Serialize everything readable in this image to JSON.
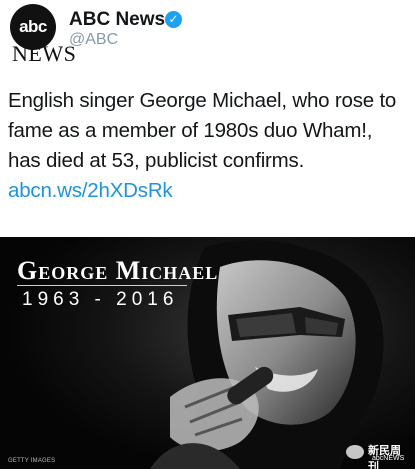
{
  "tweet": {
    "avatar": {
      "logo_text": "abc",
      "wordmark": "NEWS"
    },
    "account_name": "ABC News",
    "verified_icon": "verified-check-icon",
    "handle": "@ABC",
    "text": "English singer George Michael, who rose to fame as a member of 1980s duo Wham!, has died at 53, publicist confirms. ",
    "link": "abcn.ws/2hXDsRk",
    "link_color": "#1b95e0"
  },
  "media": {
    "name": "George Michael",
    "years": "1963 - 2016",
    "credit": "GETTY IMAGES",
    "watermark": {
      "icon": "wechat-icon",
      "title": "新民周刊",
      "subtitle": "abcNEWS"
    }
  }
}
